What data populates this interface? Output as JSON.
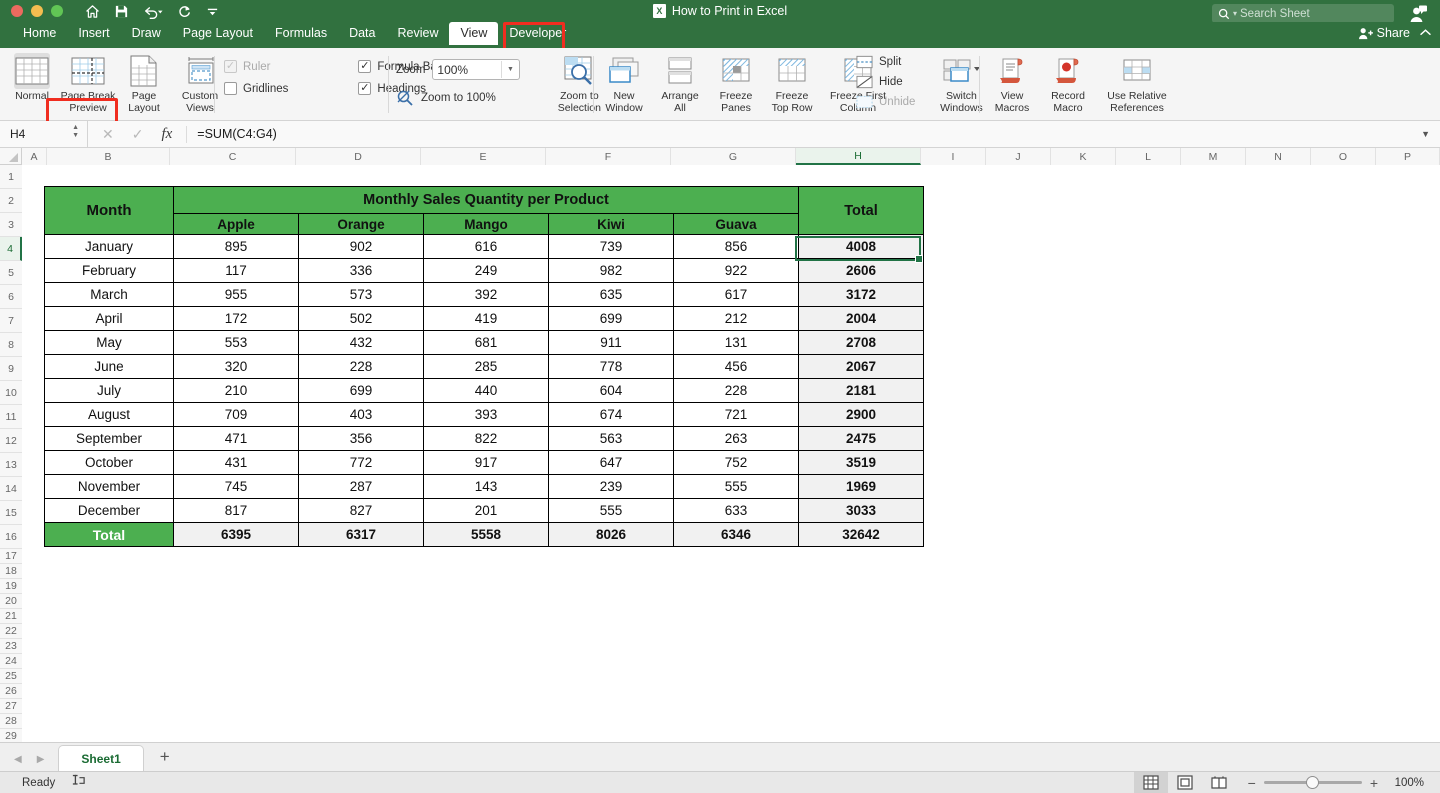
{
  "window": {
    "title": "How to Print in Excel",
    "app_icon": "excel-icon",
    "traffic_lights": [
      "close",
      "minimize",
      "maximize"
    ],
    "quick_access": [
      "home-icon",
      "save-icon",
      "undo-icon",
      "redo-icon",
      "customize-icon"
    ],
    "search_placeholder": "Search Sheet",
    "share_label": "Share",
    "collapse_icon": "chevron-up-icon"
  },
  "tabs": [
    {
      "label": "Home",
      "active": false
    },
    {
      "label": "Insert",
      "active": false
    },
    {
      "label": "Draw",
      "active": false
    },
    {
      "label": "Page Layout",
      "active": false
    },
    {
      "label": "Formulas",
      "active": false
    },
    {
      "label": "Data",
      "active": false
    },
    {
      "label": "Review",
      "active": false
    },
    {
      "label": "View",
      "active": true
    },
    {
      "label": "Developer",
      "active": false
    }
  ],
  "ribbon": {
    "workbook_views": [
      {
        "label_line1": "Normal",
        "label_line2": "",
        "icon": "normal-view-icon",
        "selected": true
      },
      {
        "label_line1": "Page Break",
        "label_line2": "Preview",
        "icon": "page-break-preview-icon",
        "selected": false,
        "highlighted": true
      },
      {
        "label_line1": "Page",
        "label_line2": "Layout",
        "icon": "page-layout-icon",
        "selected": false
      },
      {
        "label_line1": "Custom",
        "label_line2": "Views",
        "icon": "custom-views-icon",
        "selected": false
      }
    ],
    "show_checks": [
      {
        "label": "Ruler",
        "checked": true,
        "disabled": true
      },
      {
        "label": "Formula Bar",
        "checked": true,
        "disabled": false
      },
      {
        "label": "Gridlines",
        "checked": false,
        "disabled": false
      },
      {
        "label": "Headings",
        "checked": true,
        "disabled": false
      }
    ],
    "zoom": {
      "label": "Zoom",
      "value": "100%",
      "zoom_to_100_label": "Zoom to 100%",
      "zoom_to_selection_line1": "Zoom to",
      "zoom_to_selection_line2": "Selection"
    },
    "window_group": [
      {
        "line1": "New",
        "line2": "Window",
        "icon": "new-window-icon"
      },
      {
        "line1": "Arrange",
        "line2": "All",
        "icon": "arrange-all-icon"
      },
      {
        "line1": "Freeze",
        "line2": "Panes",
        "icon": "freeze-panes-icon"
      },
      {
        "line1": "Freeze",
        "line2": "Top Row",
        "icon": "freeze-top-row-icon"
      },
      {
        "line1": "Freeze First",
        "line2": "Column",
        "icon": "freeze-first-column-icon"
      }
    ],
    "split_group": [
      {
        "label": "Split",
        "icon": "split-icon",
        "disabled": false
      },
      {
        "label": "Hide",
        "icon": "hide-icon",
        "disabled": false
      },
      {
        "label": "Unhide",
        "icon": "unhide-icon",
        "disabled": true
      }
    ],
    "switch_windows": {
      "line1": "Switch",
      "line2": "Windows",
      "icon": "switch-windows-icon"
    },
    "macros": [
      {
        "line1": "View",
        "line2": "Macros",
        "icon": "view-macros-icon"
      },
      {
        "line1": "Record",
        "line2": "Macro",
        "icon": "record-macro-icon"
      },
      {
        "line1": "Use Relative",
        "line2": "References",
        "icon": "use-relative-references-icon"
      }
    ]
  },
  "formula_bar": {
    "name_box": "H4",
    "formula": "=SUM(C4:G4)",
    "cancel_icon": "cancel-icon",
    "enter_icon": "confirm-icon",
    "function_icon": "fx-icon",
    "expand_icon": "chevron-down-icon"
  },
  "grid": {
    "columns": [
      "A",
      "B",
      "C",
      "D",
      "E",
      "F",
      "G",
      "H",
      "I",
      "J",
      "K",
      "L",
      "M",
      "N",
      "O",
      "P"
    ],
    "selected_column": "H",
    "selected_row": 4,
    "rows": [
      1,
      2,
      3,
      4,
      5,
      6,
      7,
      8,
      9,
      10,
      11,
      12,
      13,
      14,
      15,
      16,
      17,
      18,
      19,
      20,
      21,
      22,
      23,
      24,
      25,
      26,
      27,
      28,
      29
    ]
  },
  "chart_data": {
    "type": "table",
    "title": "Monthly Sales Quantity per Product",
    "row_header_label": "Month",
    "total_label": "Total",
    "categories": [
      "Apple",
      "Orange",
      "Mango",
      "Kiwi",
      "Guava"
    ],
    "months": [
      "January",
      "February",
      "March",
      "April",
      "May",
      "June",
      "July",
      "August",
      "September",
      "October",
      "November",
      "December"
    ],
    "rows": [
      {
        "month": "January",
        "values": [
          895,
          902,
          616,
          739,
          856
        ],
        "total": 4008
      },
      {
        "month": "February",
        "values": [
          117,
          336,
          249,
          982,
          922
        ],
        "total": 2606
      },
      {
        "month": "March",
        "values": [
          955,
          573,
          392,
          635,
          617
        ],
        "total": 3172
      },
      {
        "month": "April",
        "values": [
          172,
          502,
          419,
          699,
          212
        ],
        "total": 2004
      },
      {
        "month": "May",
        "values": [
          553,
          432,
          681,
          911,
          131
        ],
        "total": 2708
      },
      {
        "month": "June",
        "values": [
          320,
          228,
          285,
          778,
          456
        ],
        "total": 2067
      },
      {
        "month": "July",
        "values": [
          210,
          699,
          440,
          604,
          228
        ],
        "total": 2181
      },
      {
        "month": "August",
        "values": [
          709,
          403,
          393,
          674,
          721
        ],
        "total": 2900
      },
      {
        "month": "September",
        "values": [
          471,
          356,
          822,
          563,
          263
        ],
        "total": 2475
      },
      {
        "month": "October",
        "values": [
          431,
          772,
          917,
          647,
          752
        ],
        "total": 3519
      },
      {
        "month": "November",
        "values": [
          745,
          287,
          143,
          239,
          555
        ],
        "total": 1969
      },
      {
        "month": "December",
        "values": [
          817,
          827,
          201,
          555,
          633
        ],
        "total": 3033
      }
    ],
    "column_totals": [
      6395,
      6317,
      5558,
      8026,
      6346
    ],
    "grand_total": 32642,
    "header_color": "#4caf50",
    "total_fill": "#f1f1f1"
  },
  "sheet_tabs": {
    "prev_icon": "prev-sheet-icon",
    "next_icon": "next-sheet-icon",
    "tabs": [
      {
        "label": "Sheet1",
        "active": true
      }
    ],
    "add_label": "+"
  },
  "status_bar": {
    "state": "Ready",
    "accessibility_icon": "accessibility-icon",
    "views": [
      {
        "icon": "normal-view-icon",
        "active": true
      },
      {
        "icon": "page-layout-view-icon",
        "active": false
      },
      {
        "icon": "page-break-view-icon",
        "active": false
      }
    ],
    "zoom_out": "−",
    "zoom_in": "+",
    "zoom_level": "100%"
  },
  "colors": {
    "brand_green": "#31713f",
    "table_green": "#4caf50",
    "selection_green": "#217346",
    "annotation_red": "#f02d20"
  }
}
